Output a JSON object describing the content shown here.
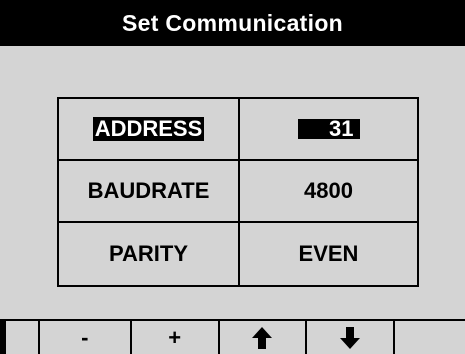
{
  "window": {
    "title": "Set Communication"
  },
  "settings": [
    {
      "label": "ADDRESS",
      "value": "31",
      "selected": true
    },
    {
      "label": "BAUDRATE",
      "value": "4800",
      "selected": false
    },
    {
      "label": "PARITY",
      "value": "EVEN",
      "selected": false
    }
  ],
  "softkeys": {
    "minus_label": "-",
    "plus_label": "+",
    "up_icon": "arrow-up-icon",
    "down_icon": "arrow-down-icon"
  },
  "colors": {
    "background": "#d4d4d4",
    "titlebar": "#000000",
    "highlight": "#000000"
  }
}
